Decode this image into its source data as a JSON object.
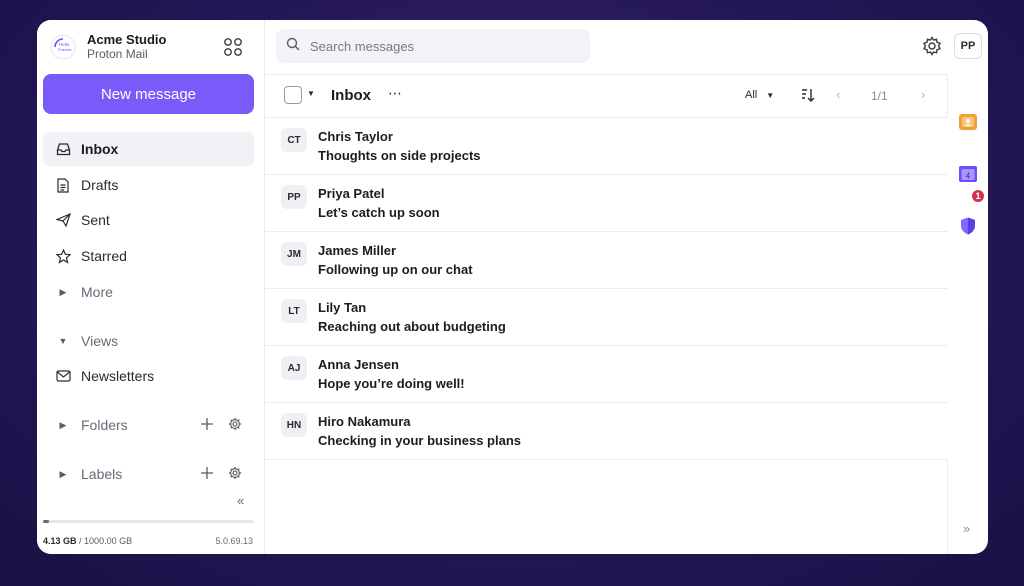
{
  "brand": {
    "org": "Acme Studio",
    "app": "Proton Mail"
  },
  "sidebar": {
    "new_message": "New message",
    "items": [
      {
        "label": "Inbox",
        "icon": "inbox-icon"
      },
      {
        "label": "Drafts",
        "icon": "file-icon"
      },
      {
        "label": "Sent",
        "icon": "paper-plane-icon"
      },
      {
        "label": "Starred",
        "icon": "star-icon"
      },
      {
        "label": "More",
        "icon": "caret-right-icon"
      }
    ],
    "views_label": "Views",
    "newsletters_label": "Newsletters",
    "folders_label": "Folders",
    "labels_label": "Labels",
    "storage_used": "4.13 GB",
    "storage_total": "/ 1000.00 GB",
    "storage_fraction": 0.004,
    "version": "5.0.69.13"
  },
  "header": {
    "search_placeholder": "Search messages",
    "avatar_initials": "PP"
  },
  "toolbar": {
    "title": "Inbox",
    "more": "⋯",
    "filter": "All",
    "page": "1/1"
  },
  "messages": [
    {
      "initials": "CT",
      "sender": "Chris Taylor",
      "subject": "Thoughts on side projects"
    },
    {
      "initials": "PP",
      "sender": "Priya Patel",
      "subject": "Let’s catch up soon"
    },
    {
      "initials": "JM",
      "sender": "James Miller",
      "subject": "Following up on our chat"
    },
    {
      "initials": "LT",
      "sender": "Lily Tan",
      "subject": "Reaching out about budgeting"
    },
    {
      "initials": "AJ",
      "sender": "Anna Jensen",
      "subject": "Hope you’re doing well!"
    },
    {
      "initials": "HN",
      "sender": "Hiro Nakamura",
      "subject": "Checking in your business plans"
    }
  ],
  "rail": {
    "calendar_day": "4",
    "security_badge": "1"
  },
  "colors": {
    "accent": "#7a5af8",
    "background": "#241757",
    "badge": "#d0334f"
  }
}
